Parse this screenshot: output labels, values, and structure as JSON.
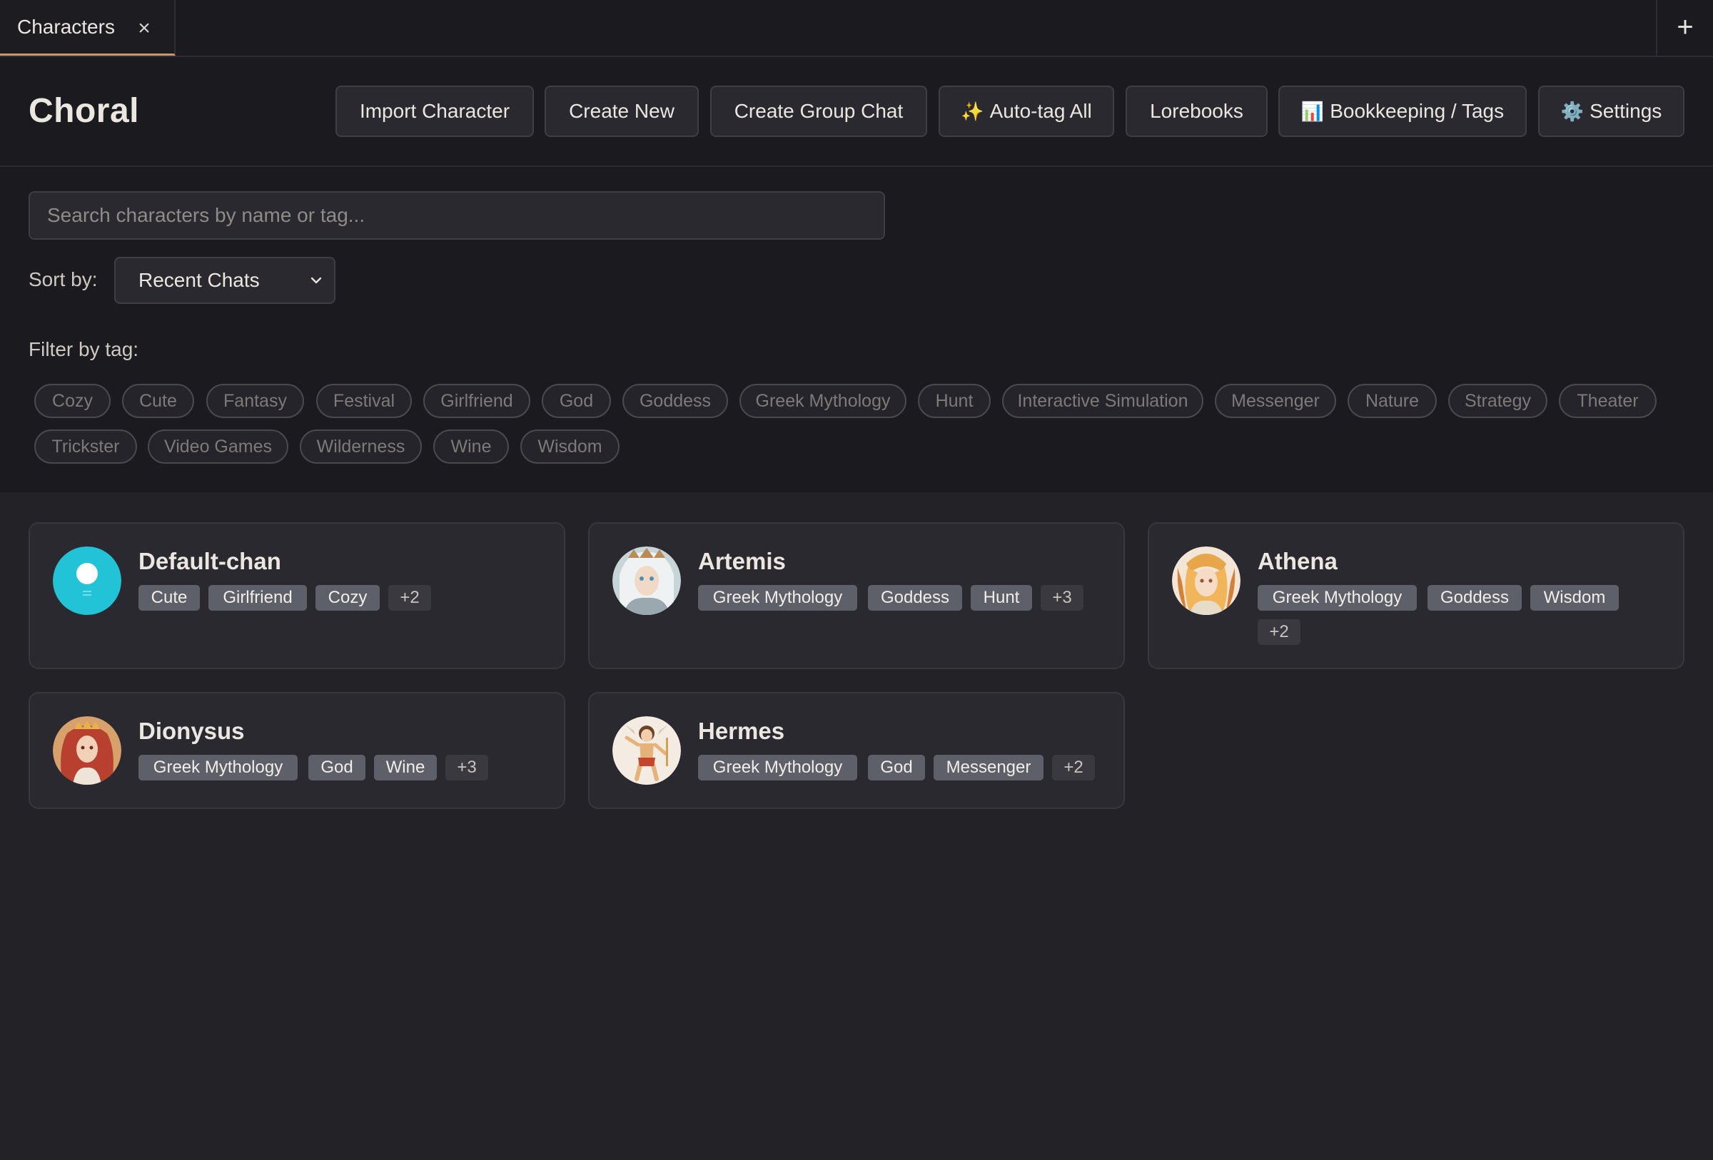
{
  "tabs": [
    {
      "label": "Characters",
      "close": "×"
    }
  ],
  "new_tab": "+",
  "header": {
    "title": "Choral",
    "buttons": [
      {
        "label": "Import Character",
        "icon": ""
      },
      {
        "label": "Create New",
        "icon": ""
      },
      {
        "label": "Create Group Chat",
        "icon": ""
      },
      {
        "label": "Auto-tag All",
        "icon": "✨"
      },
      {
        "label": "Lorebooks",
        "icon": ""
      },
      {
        "label": "Bookkeeping / Tags",
        "icon": "📊"
      },
      {
        "label": "Settings",
        "icon": "⚙️"
      }
    ]
  },
  "search": {
    "placeholder": "Search characters by name or tag...",
    "value": ""
  },
  "sort": {
    "label": "Sort by:",
    "value": "Recent Chats"
  },
  "filter": {
    "label": "Filter by tag:",
    "tags": [
      "Cozy",
      "Cute",
      "Fantasy",
      "Festival",
      "Girlfriend",
      "God",
      "Goddess",
      "Greek Mythology",
      "Hunt",
      "Interactive Simulation",
      "Messenger",
      "Nature",
      "Strategy",
      "Theater",
      "Trickster",
      "Video Games",
      "Wilderness",
      "Wine",
      "Wisdom"
    ]
  },
  "characters": [
    {
      "name": "Default-chan",
      "tags": [
        "Cute",
        "Girlfriend",
        "Cozy"
      ],
      "more": "+2"
    },
    {
      "name": "Artemis",
      "tags": [
        "Greek Mythology",
        "Goddess",
        "Hunt"
      ],
      "more": "+3"
    },
    {
      "name": "Athena",
      "tags": [
        "Greek Mythology",
        "Goddess",
        "Wisdom"
      ],
      "more": "+2"
    },
    {
      "name": "Dionysus",
      "tags": [
        "Greek Mythology",
        "God",
        "Wine"
      ],
      "more": "+3"
    },
    {
      "name": "Hermes",
      "tags": [
        "Greek Mythology",
        "God",
        "Messenger"
      ],
      "more": "+2"
    }
  ],
  "colors": {
    "accent": "#c9956a",
    "default_avatar": "#22c3d6"
  }
}
